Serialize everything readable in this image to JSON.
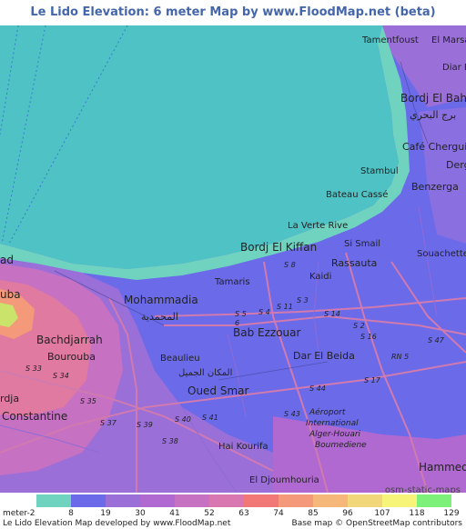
{
  "title": "Le Lido Elevation: 6 meter Map by www.FloodMap.net (beta)",
  "colors": {
    "sea": "#4fc2c5",
    "coast": "#6fd3c0",
    "low": "#6b6bea",
    "mid": "#9a6fd8",
    "high": "#c771c3",
    "hill": "#e07aa0",
    "peak": "#f49a7a",
    "top": "#c9e36b",
    "road": "#d07ab0",
    "title": "#4466aa"
  },
  "map_labels": {
    "tamentfoust": "Tamentfoust",
    "el_marsa": "El Marsa",
    "diar_el": "Diar E",
    "bordj_el_bahri": "Bordj El Bah",
    "bordj_el_bahri_ar": "برج البحري",
    "cafe_chergui": "Café Chergui",
    "derg": "Derg",
    "stambul": "Stambul",
    "bateau_casse": "Bateau Cassé",
    "benzerga": "Benzerga",
    "la_verte_rive": "La Verte Rive",
    "bordj_el_kiffan": "Bordj El Kiffan",
    "si_smail": "Si Smail",
    "rassauta": "Rassauta",
    "souachette": "Souachette",
    "kaidi": "Kaidi",
    "tamaris": "Tamaris",
    "mohammadia": "Mohammadia",
    "mohammadia_ar": "المحمدية",
    "bab_ezzouar": "Bab Ezzouar",
    "bachdjarrah": "Bachdjarrah",
    "bourouba": "Bourouba",
    "beaulieu": "Beaulieu",
    "beaulieu_ar": "المكان الجميل",
    "dar_el_beida": "Dar El Beida",
    "oued_smar": "Oued Smar",
    "constantine": "Constantine",
    "aeroport_1": "Aéroport",
    "aeroport_2": "International",
    "aeroport_3": "Alger-Houari",
    "aeroport_4": "Boumediene",
    "hai_kourifa": "Hai Kourifa",
    "el_djoumhouria": "El Djoumhouria",
    "hammedi": "Hammedi",
    "ad": "ad",
    "uba": "uba",
    "rdja": "rdja",
    "rn5": "RN 5",
    "s47": "S 47",
    "s5": "S 5",
    "s14": "S 14",
    "s11": "S 11",
    "s8": "S 8",
    "s4": "S 4",
    "s3": "S 3",
    "s2": "S 2",
    "s16": "S 16",
    "s6": "6",
    "s43": "S 43",
    "s44": "S 44",
    "s39": "S 39",
    "s40": "S 40",
    "s41": "S 41",
    "s37": "S 37",
    "s35": "S 35",
    "s34": "S 34",
    "s33": "S 33",
    "s38": "S 38",
    "s17": "S 17"
  },
  "osm_credit": "osm-static-maps",
  "legend": {
    "unit": "meter",
    "values": [
      "-2",
      "8",
      "19",
      "30",
      "41",
      "52",
      "63",
      "74",
      "85",
      "96",
      "107",
      "118",
      "129"
    ],
    "colors": [
      "#6fd3c0",
      "#6b6bea",
      "#9a6fd8",
      "#b069d0",
      "#c771c3",
      "#d877b0",
      "#f27878",
      "#f49a7a",
      "#f6b87a",
      "#f2d67a",
      "#f6f57a",
      "#7df07a",
      "#9de46b"
    ]
  },
  "footer": {
    "left": "Le Lido Elevation Map developed by www.FloodMap.net",
    "right": "Base map © OpenStreetMap contributors"
  }
}
